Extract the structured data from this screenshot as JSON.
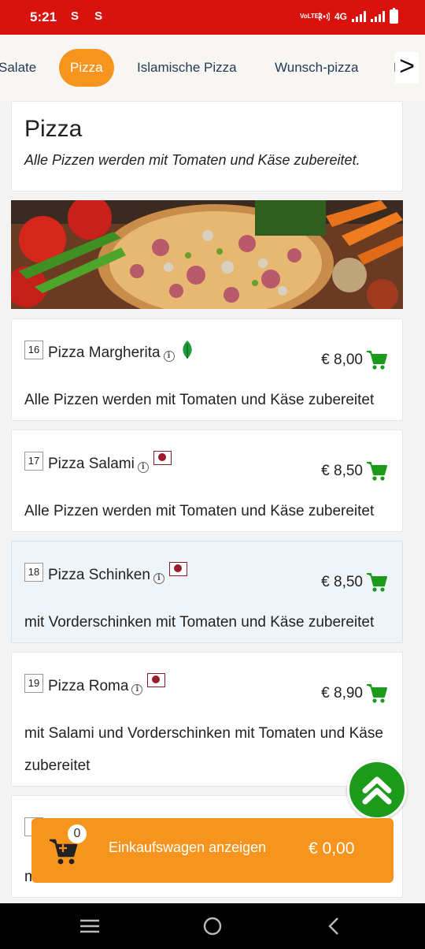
{
  "status_bar": {
    "time": "5:21",
    "left_icons": "S S",
    "network_label": "VoLTE2",
    "net_type": "4G",
    "icons": [
      "sim-icon",
      "hotspot-icon",
      "signal-icon",
      "battery-icon"
    ]
  },
  "tabs": {
    "items": [
      {
        "label": "Salate"
      },
      {
        "label": "Pizza"
      },
      {
        "label": "Islamische Pizza"
      },
      {
        "label": "Wunsch-pizza"
      },
      {
        "label": "F"
      }
    ],
    "next_glyph": ">"
  },
  "category": {
    "title": "Pizza",
    "description": "Alle Pizzen werden mit Tomaten und Käse zubereitet."
  },
  "items": [
    {
      "number": "16",
      "name": "Pizza Margherita",
      "price": "€ 8,00",
      "description": "Alle Pizzen werden mit Tomaten und Käse zubereitet",
      "badge": "vegetarian-leaf-icon"
    },
    {
      "number": "17",
      "name": "Pizza Salami",
      "price": "€ 8,50",
      "description": "Alle Pizzen werden mit Tomaten und Käse zubereitet",
      "badge": "meat-icon"
    },
    {
      "number": "18",
      "name": "Pizza Schinken",
      "price": "€ 8,50",
      "description": "mit Vorderschinken mit Tomaten und Käse zubereitet",
      "badge": "meat-icon"
    },
    {
      "number": "19",
      "name": "Pizza Roma",
      "price": "€ 8,90",
      "description": "mit Salami und Vorderschinken mit Tomaten und Käse zubereitet",
      "badge": "meat-icon"
    },
    {
      "number": "2",
      "desc_start": "m"
    }
  ],
  "cart": {
    "count": "0",
    "label": "Einkaufswagen anzeigen",
    "total": "€ 0,00"
  },
  "colors": {
    "status_bar": "#d9120e",
    "accent": "#f7941d",
    "cart_icon": "#1c9a1a",
    "highlight_row": "#eef4f7",
    "meat_badge": "#9b1a2c"
  }
}
